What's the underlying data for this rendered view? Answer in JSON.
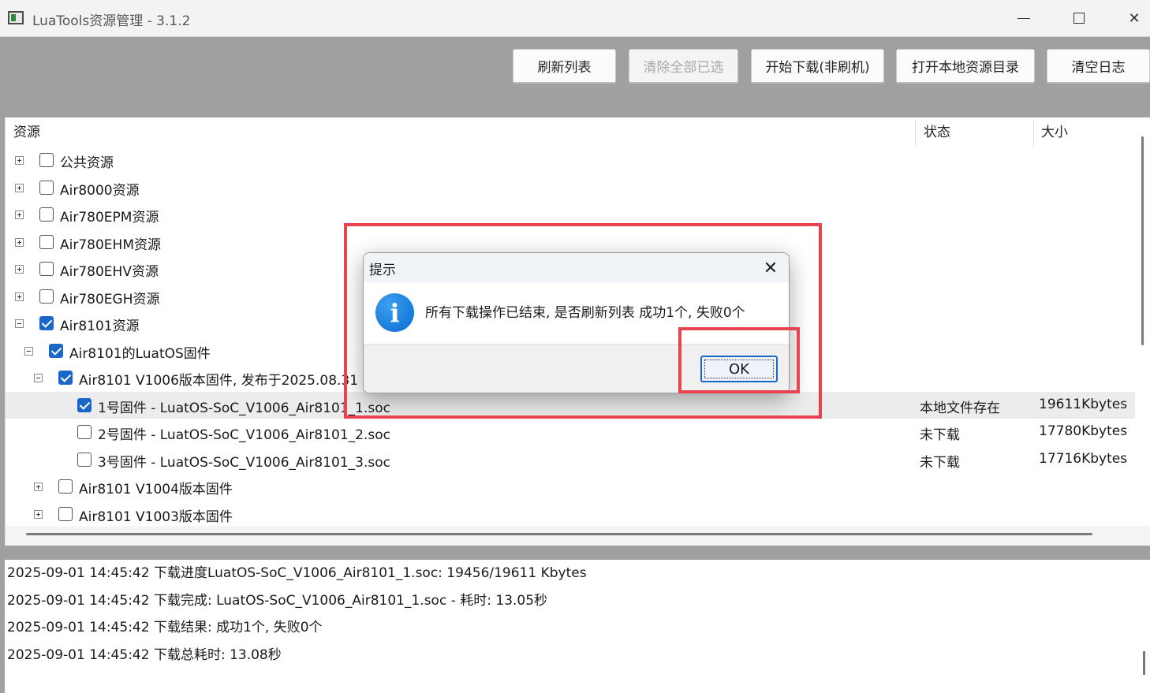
{
  "window": {
    "title": "LuaTools资源管理 - 3.1.2",
    "minimize_glyph": "—",
    "close_glyph": "✕"
  },
  "toolbar": {
    "refresh_label": "刷新列表",
    "clear_selected_label": "清除全部已选",
    "start_download_label": "开始下载(非刷机)",
    "open_local_dir_label": "打开本地资源目录",
    "clear_log_label": "清空日志"
  },
  "tree": {
    "columns": {
      "resource": "资源",
      "status": "状态",
      "size": "大小"
    },
    "rows": [
      {
        "label": "公共资源",
        "expander": "plus",
        "checked": false,
        "status": "",
        "size": ""
      },
      {
        "label": "Air8000资源",
        "expander": "plus",
        "checked": false,
        "status": "",
        "size": ""
      },
      {
        "label": "Air780EPM资源",
        "expander": "plus",
        "checked": false,
        "status": "",
        "size": ""
      },
      {
        "label": "Air780EHM资源",
        "expander": "plus",
        "checked": false,
        "status": "",
        "size": ""
      },
      {
        "label": "Air780EHV资源",
        "expander": "plus",
        "checked": false,
        "status": "",
        "size": ""
      },
      {
        "label": "Air780EGH资源",
        "expander": "plus",
        "checked": false,
        "status": "",
        "size": ""
      },
      {
        "label": "Air8101资源",
        "expander": "minus",
        "checked": true,
        "status": "",
        "size": ""
      },
      {
        "label": "Air8101的LuatOS固件",
        "expander": "minus",
        "checked": true,
        "status": "",
        "size": ""
      },
      {
        "label": "Air8101 V1006版本固件, 发布于2025.08.31",
        "expander": "minus",
        "checked": true,
        "status": "",
        "size": ""
      },
      {
        "label": "1号固件 - LuatOS-SoC_V1006_Air8101_1.soc",
        "expander": "none",
        "checked": true,
        "status": "本地文件存在",
        "size": "19611Kbytes",
        "selected": true
      },
      {
        "label": "2号固件 - LuatOS-SoC_V1006_Air8101_2.soc",
        "expander": "none",
        "checked": false,
        "status": "未下载",
        "size": "17780Kbytes"
      },
      {
        "label": "3号固件 - LuatOS-SoC_V1006_Air8101_3.soc",
        "expander": "none",
        "checked": false,
        "status": "未下载",
        "size": "17716Kbytes"
      },
      {
        "label": "Air8101 V1004版本固件",
        "expander": "plus",
        "checked": false,
        "status": "",
        "size": ""
      },
      {
        "label": "Air8101 V1003版本固件",
        "expander": "plus",
        "checked": false,
        "status": "",
        "size": ""
      }
    ]
  },
  "log": {
    "lines": [
      "2025-09-01 14:45:42 下载进度LuatOS-SoC_V1006_Air8101_1.soc: 19456/19611 Kbytes",
      "2025-09-01 14:45:42 下载完成: LuatOS-SoC_V1006_Air8101_1.soc - 耗时: 13.05秒",
      "2025-09-01 14:45:42 下载结果:  成功1个, 失败0个",
      "2025-09-01 14:45:42 下载总耗时: 13.08秒"
    ]
  },
  "dialog": {
    "title": "提示",
    "message": "所有下载操作已结束, 是否刷新列表 成功1个, 失败0个",
    "ok_label": "OK",
    "close_glyph": "✕",
    "icon_glyph": "i",
    "icon_name": "info-icon"
  },
  "colors": {
    "accent": "#1a66c9",
    "highlight": "#e8434e",
    "background": "#a0a0a0"
  }
}
